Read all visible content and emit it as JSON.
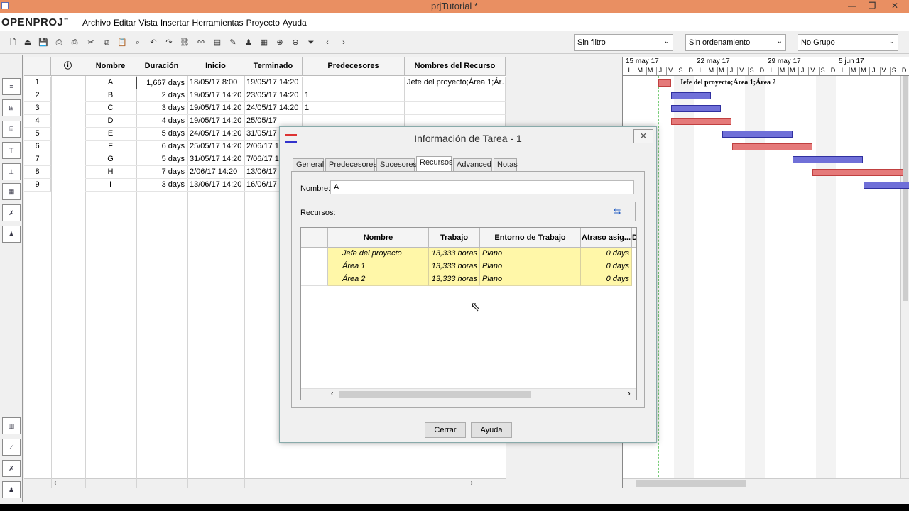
{
  "window": {
    "title": "prjTutorial *"
  },
  "menubar": {
    "logo": "OPENPROJ",
    "logo_mark": "™",
    "items": [
      "Archivo",
      "Editar",
      "Vista",
      "Insertar",
      "Herramientas",
      "Proyecto",
      "Ayuda"
    ]
  },
  "filters": {
    "filter": "Sin filtro",
    "sort": "Sin ordenamiento",
    "group": "No Grupo"
  },
  "grid": {
    "headers": [
      "",
      "ⓘ",
      "Nombre",
      "Duración",
      "Inicio",
      "Terminado",
      "Predecesores",
      "Nombres del Recurso"
    ],
    "rows": [
      {
        "id": "1",
        "name": "A",
        "duration": "1,667 days",
        "start": "18/05/17 8:00",
        "finish": "19/05/17 14:20",
        "pred": "",
        "resources": "Jefe del proyecto;Área 1;Ár…"
      },
      {
        "id": "2",
        "name": "B",
        "duration": "2 days",
        "start": "19/05/17 14:20",
        "finish": "23/05/17 14:20",
        "pred": "1",
        "resources": ""
      },
      {
        "id": "3",
        "name": "C",
        "duration": "3 days",
        "start": "19/05/17 14:20",
        "finish": "24/05/17 14:20",
        "pred": "1",
        "resources": ""
      },
      {
        "id": "4",
        "name": "D",
        "duration": "4 days",
        "start": "19/05/17 14:20",
        "finish": "25/05/17",
        "pred": "",
        "resources": ""
      },
      {
        "id": "5",
        "name": "E",
        "duration": "5 days",
        "start": "24/05/17 14:20",
        "finish": "31/05/17",
        "pred": "",
        "resources": ""
      },
      {
        "id": "6",
        "name": "F",
        "duration": "6 days",
        "start": "25/05/17 14:20",
        "finish": "2/06/17 1(",
        "pred": "",
        "resources": ""
      },
      {
        "id": "7",
        "name": "G",
        "duration": "5 days",
        "start": "31/05/17 14:20",
        "finish": "7/06/17 1(",
        "pred": "",
        "resources": ""
      },
      {
        "id": "8",
        "name": "H",
        "duration": "7 days",
        "start": "2/06/17 14:20",
        "finish": "13/06/17",
        "pred": "",
        "resources": ""
      },
      {
        "id": "9",
        "name": "I",
        "duration": "3 days",
        "start": "13/06/17 14:20",
        "finish": "16/06/17",
        "pred": "",
        "resources": ""
      }
    ]
  },
  "gantt": {
    "weeks": [
      "15 may 17",
      "22 may 17",
      "29 may 17",
      "5 jun 17"
    ],
    "days": [
      "L",
      "M",
      "M",
      "J",
      "V",
      "S",
      "D",
      "L",
      "M",
      "M",
      "J",
      "V",
      "S",
      "D",
      "L",
      "M",
      "M",
      "J",
      "V",
      "S",
      "D",
      "L",
      "M",
      "M",
      "J",
      "V",
      "S",
      "D",
      "L",
      "M",
      "M"
    ],
    "bar_label": "Jefe del proyecto;Área 1;Área 2",
    "colors": {
      "critical": "#e57a7a",
      "normal": "#7070d8"
    }
  },
  "dialog": {
    "title": "Información de Tarea - 1",
    "tabs": [
      "General",
      "Predecesores",
      "Sucesores",
      "Recursos",
      "Advanced",
      "Notas"
    ],
    "active_tab": "Recursos",
    "name_label": "Nombre:",
    "name_value": "A",
    "resources_label": "Recursos:",
    "table_headers": [
      "Nombre",
      "Trabajo",
      "Entorno de Trabajo",
      "Atraso asig...",
      "D"
    ],
    "resources": [
      {
        "name": "Jefe del proyecto",
        "work": "13,333 horas",
        "contour": "Plano",
        "delay": "0 days"
      },
      {
        "name": "Área 1",
        "work": "13,333 horas",
        "contour": "Plano",
        "delay": "0 days"
      },
      {
        "name": "Área 2",
        "work": "13,333 horas",
        "contour": "Plano",
        "delay": "0 days"
      }
    ],
    "close_button": "Cerrar",
    "help_button": "Ayuda"
  }
}
